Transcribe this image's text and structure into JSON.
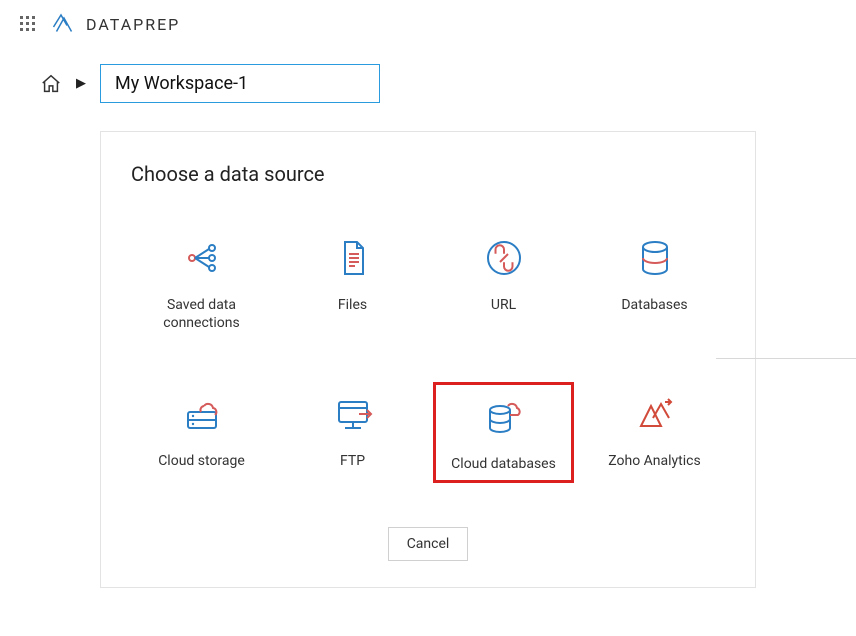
{
  "brand": "DATAPREP",
  "breadcrumb": {
    "workspace_name": "My Workspace-1"
  },
  "panel": {
    "title": "Choose a data source",
    "sources": [
      {
        "label": "Saved data connections"
      },
      {
        "label": "Files"
      },
      {
        "label": "URL"
      },
      {
        "label": "Databases"
      },
      {
        "label": "Cloud storage"
      },
      {
        "label": "FTP"
      },
      {
        "label": "Cloud databases",
        "highlighted": true
      },
      {
        "label": "Zoho Analytics"
      }
    ],
    "cancel_label": "Cancel"
  }
}
